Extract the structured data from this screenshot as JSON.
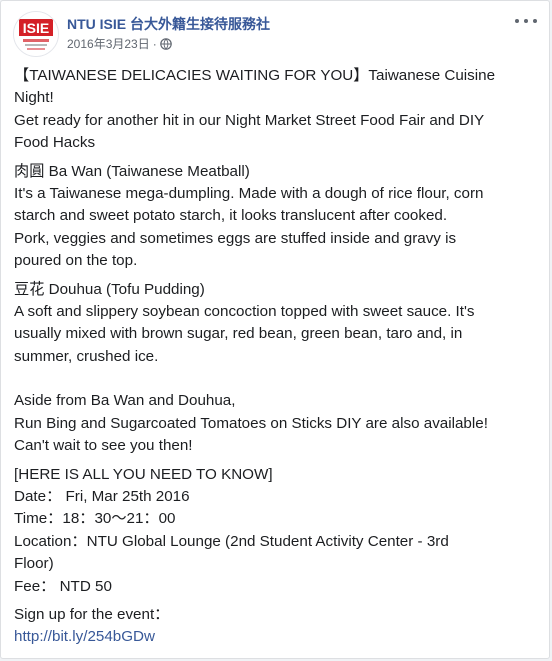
{
  "post": {
    "page_name": "NTU ISIE 台大外籍生接待服務社",
    "date": "2016年3月23日",
    "separator": "·",
    "privacy_icon": "globe-icon",
    "more_icon": "more-options-icon",
    "avatar_logo_text": "ISIE"
  },
  "content": {
    "intro": [
      "【TAIWANESE DELICACIES WAITING FOR YOU】Taiwanese Cuisine",
      "Night!",
      "Get ready for another hit in our Night Market Street Food Fair and DIY",
      "Food Hacks"
    ],
    "bawan": [
      "肉圓 Ba Wan (Taiwanese Meatball)",
      "It's a Taiwanese mega-dumpling. Made with a dough of rice flour, corn",
      "starch and sweet potato starch, it looks translucent after cooked.",
      "Pork, veggies and sometimes eggs are stuffed inside and gravy is",
      "poured on the top."
    ],
    "douhua": [
      "豆花 Douhua (Tofu Pudding)",
      "A soft and slippery soybean concoction topped with sweet sauce. It's",
      "usually mixed with brown sugar, red bean, green bean, taro and, in",
      "summer, crushed ice."
    ],
    "aside": [
      "Aside from Ba Wan and Douhua,",
      "Run Bing and Sugarcoated Tomatoes on Sticks DIY are also available!",
      "Can't wait to see you then!"
    ],
    "info": [
      "[HERE IS ALL YOU NEED TO KNOW]",
      "Date： Fri, Mar 25th 2016",
      "Time：18：30～21：00",
      "Location：NTU Global Lounge (2nd Student Activity Center - 3rd",
      "Floor)",
      "Fee： NTD 50"
    ],
    "signup_label": "Sign up for the event：",
    "signup_link": "http://bit.ly/254bGDw"
  },
  "colors": {
    "link": "#385898",
    "text": "#1c1e21",
    "meta": "#616770",
    "logo_red": "#d42027"
  }
}
